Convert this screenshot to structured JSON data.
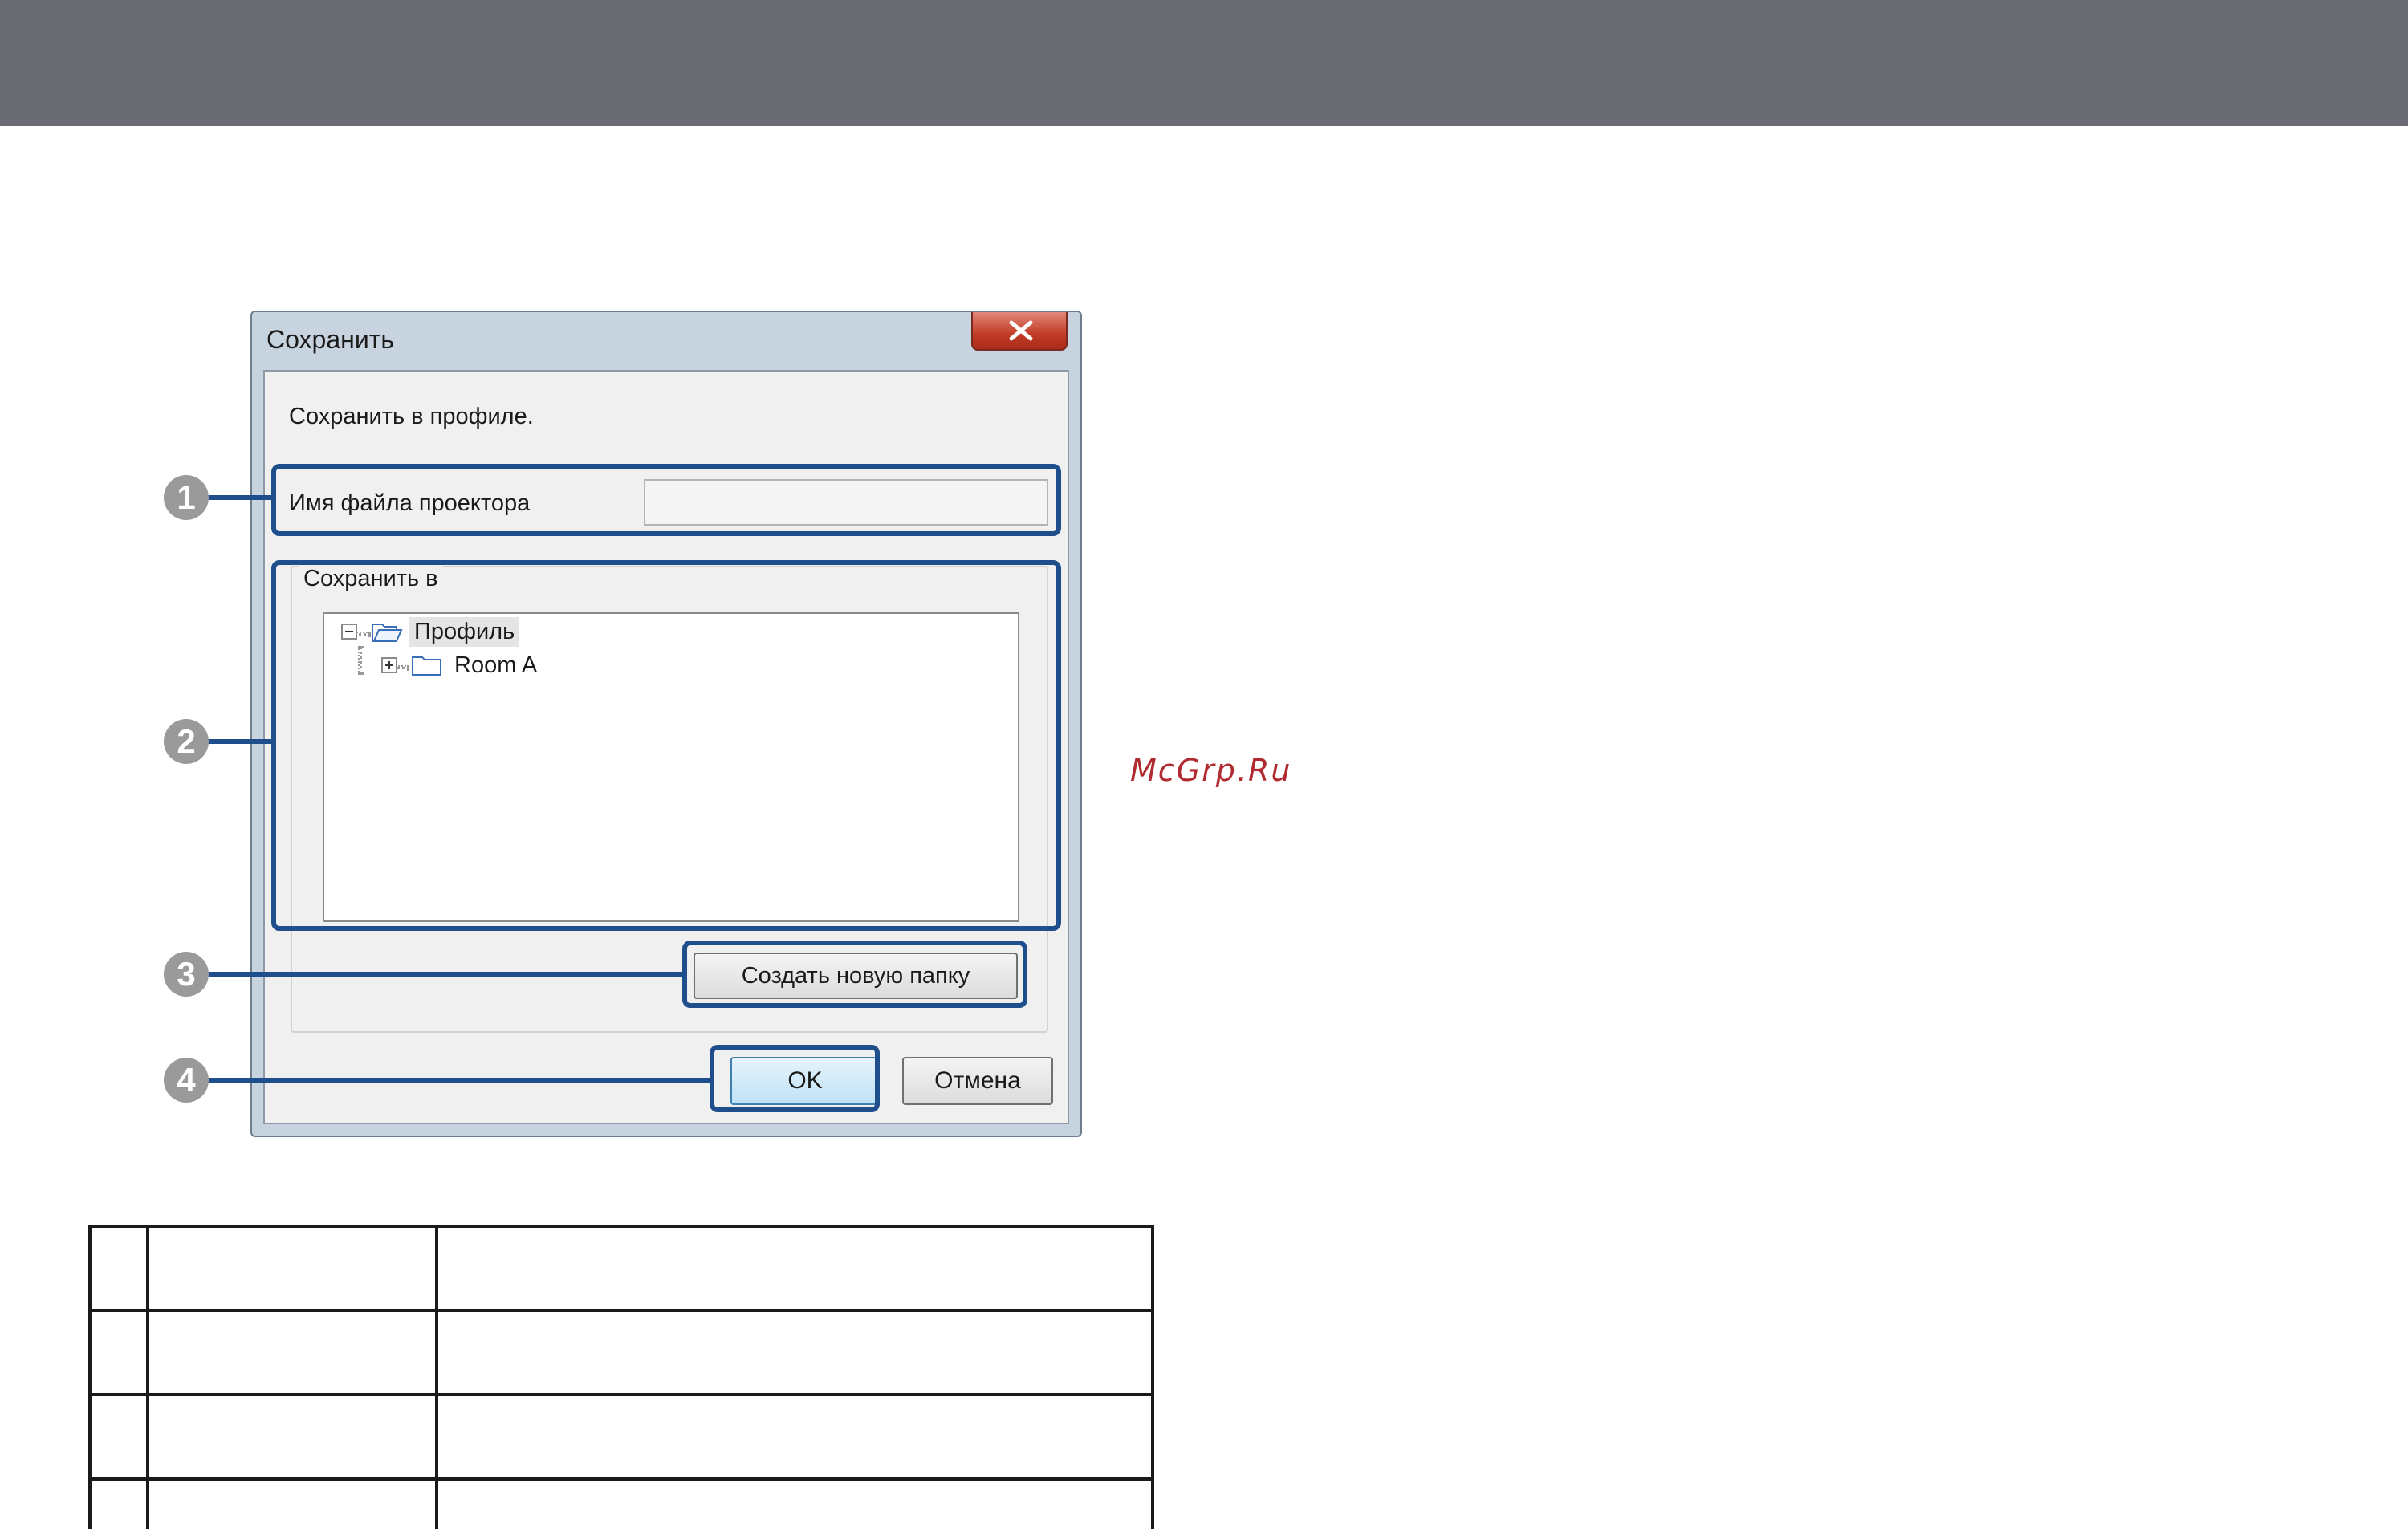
{
  "dialog": {
    "title": "Сохранить",
    "prompt": "Сохранить в профиле.",
    "file_name_label": "Имя файла проектора",
    "file_name_value": "",
    "save_to_group_label": "Сохранить в",
    "tree": [
      {
        "label": "Профиль",
        "expanded": true,
        "selected": true,
        "icon": "folder-open-icon"
      },
      {
        "label": "Room A",
        "expanded": false,
        "selected": false,
        "icon": "folder-icon"
      }
    ],
    "new_folder_button": "Создать новую папку",
    "ok_button": "OK",
    "cancel_button": "Отмена"
  },
  "callouts": [
    "1",
    "2",
    "3",
    "4"
  ],
  "watermark": "McGrp.Ru",
  "legend_table": {
    "rows": [
      [
        "",
        "",
        ""
      ],
      [
        "",
        "",
        ""
      ],
      [
        "",
        "",
        ""
      ],
      [
        "",
        "",
        ""
      ]
    ]
  },
  "colors": {
    "header_bar": "#6b6b73",
    "callout_outline": "#1f4e8c",
    "callout_marker": "#9a9a9a",
    "watermark": "#b02a30",
    "close_button": "#c23b26"
  }
}
